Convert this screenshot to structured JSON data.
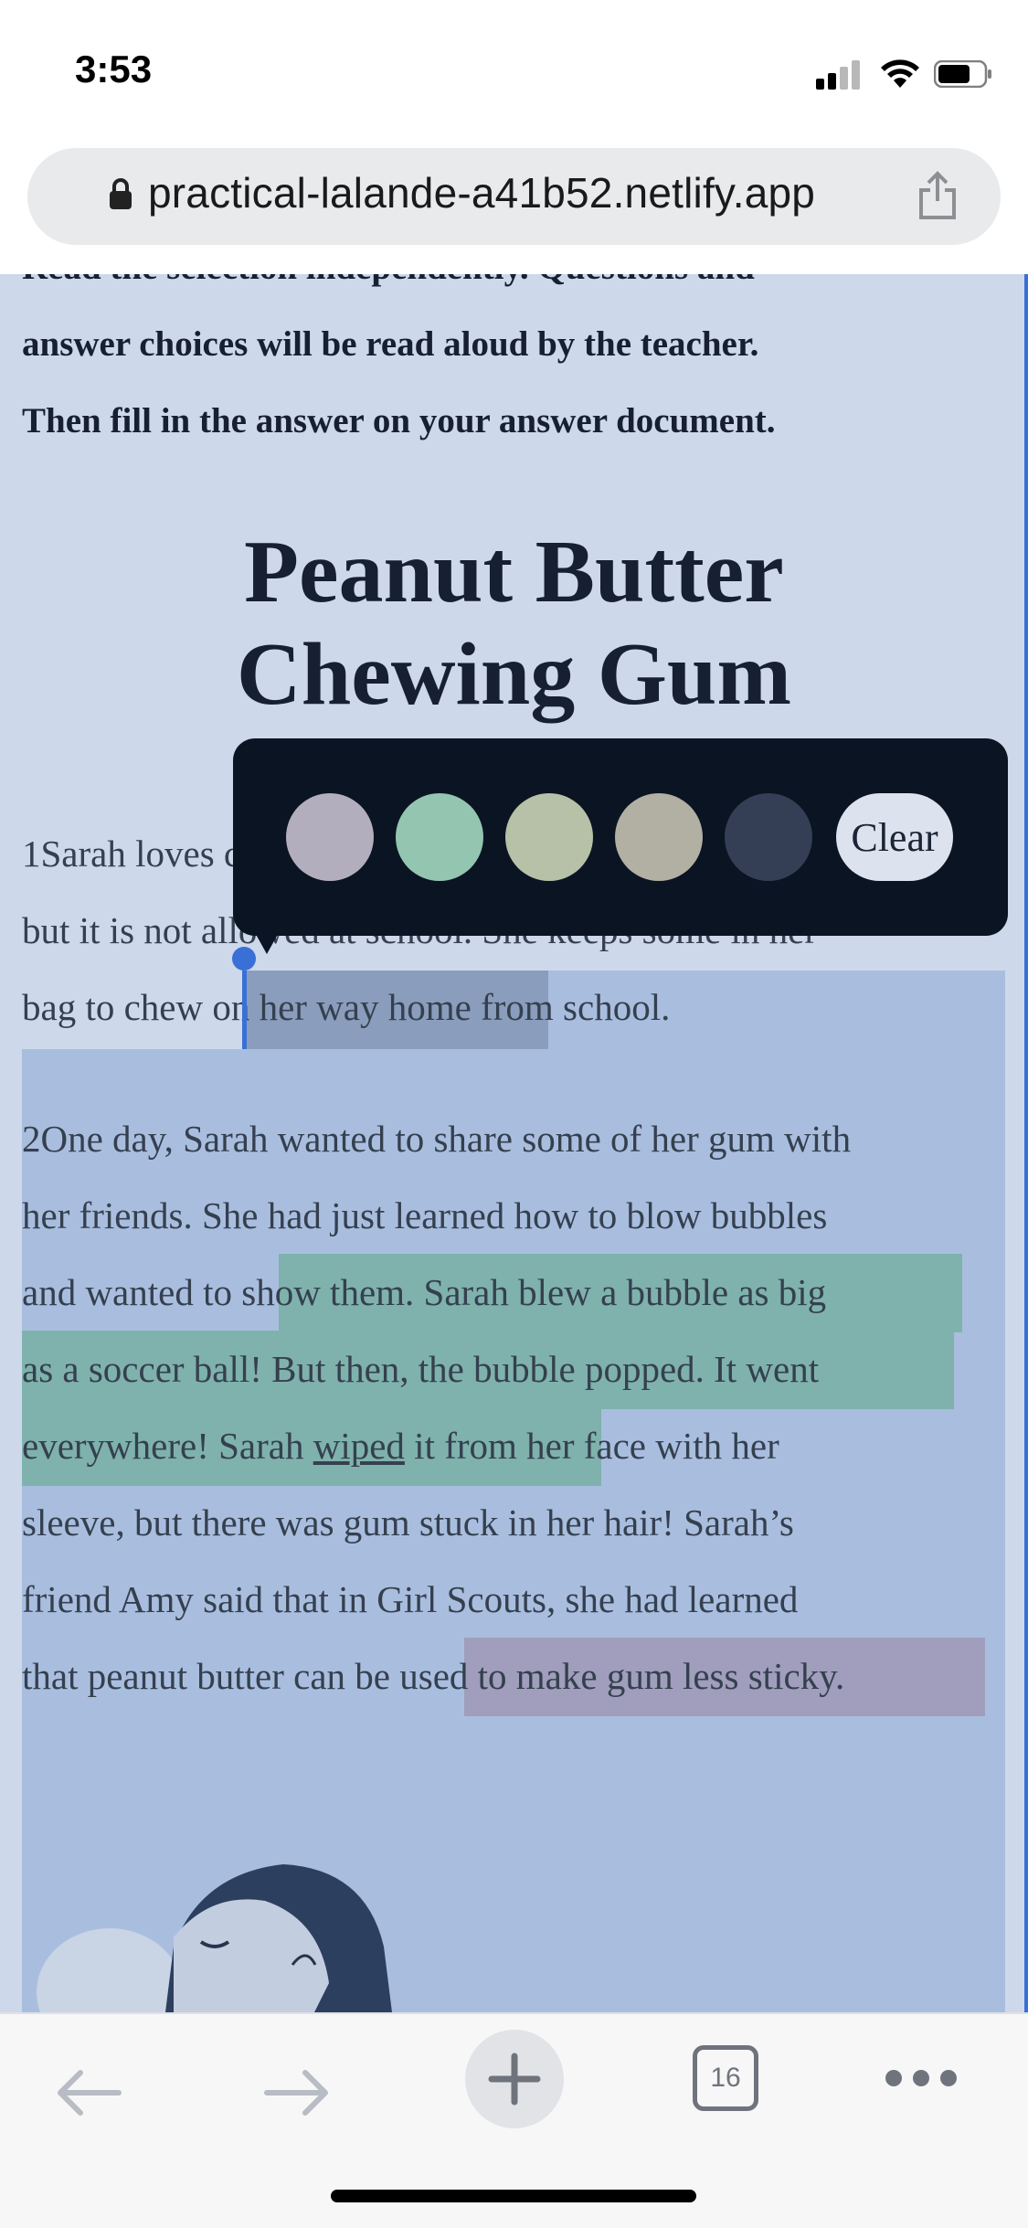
{
  "status_bar": {
    "time": "3:53"
  },
  "browser": {
    "url": "practical-lalande-a41b52.netlify.app",
    "tab_count": "16"
  },
  "page": {
    "instructions": [
      "Read the selection independently. Questions and",
      "answer choices will be read aloud by the teacher.",
      "Then fill in the answer on your answer document."
    ],
    "title_line1": "Peanut Butter",
    "title_line2": "Chewing Gum",
    "p1": {
      "l1": "1Sarah loves chewing gum,",
      "l2": "but it is not allowed at school. She keeps some in her",
      "l3_a": "bag to chew ",
      "l3_b": "on her way home",
      "l3_c": " from school."
    },
    "p2": {
      "l1": "2One day, Sarah wanted to share some of her gum with",
      "l2": "her friends. She had just learned how to blow bubbles",
      "l3_a": "and wanted to ",
      "l3_b": "show them. Sarah blew a bubble as big",
      "l4": "as a soccer ball! But then, the bubble popped. It went",
      "l5_a": "everywhere! Sarah ",
      "l5_b": "wiped",
      "l5_c": " it from",
      "l5_d": " her face with her",
      "l6": "sleeve, but there was gum stuck in her hair! Sarah’s",
      "l7": "friend Amy said that in Girl Scouts, she had learned",
      "l8_a": "that peanut butter can be ",
      "l8_b": "used to make gum less sticky."
    }
  },
  "highlighter_popup": {
    "swatches": [
      {
        "name": "purple",
        "color": "#b3aebd"
      },
      {
        "name": "green",
        "color": "#93c5b1"
      },
      {
        "name": "yellow-green",
        "color": "#b7c1a8"
      },
      {
        "name": "tan",
        "color": "#b2afa3"
      },
      {
        "name": "slate",
        "color": "#343e55"
      }
    ],
    "clear_label": "Clear"
  },
  "colors": {
    "selection": "#3a6fd8",
    "page_bg": "#cdd9ea",
    "text": "#172033"
  }
}
